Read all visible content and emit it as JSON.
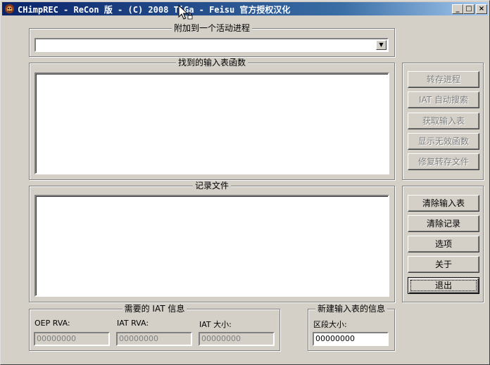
{
  "window": {
    "title": "CHimpREC - ReCon 版 - (C) 2008 TiGa - Feisu 官方授权汉化",
    "controls": {
      "minimize": "_",
      "maximize": "□",
      "close": "×"
    }
  },
  "attach": {
    "title": "附加到一个活动进程",
    "selected": ""
  },
  "imports": {
    "title": "找到的输入表函数"
  },
  "log": {
    "title": "记录文件"
  },
  "buttons_top": [
    {
      "label": "转存进程",
      "enabled": false
    },
    {
      "label": "IAT 自动搜索",
      "enabled": false
    },
    {
      "label": "获取输入表",
      "enabled": false
    },
    {
      "label": "显示无效函数",
      "enabled": false
    },
    {
      "label": "修复转存文件",
      "enabled": false
    }
  ],
  "buttons_bottom": [
    {
      "label": "清除输入表"
    },
    {
      "label": "清除记录"
    },
    {
      "label": "选项"
    },
    {
      "label": "关于"
    },
    {
      "label": "退出"
    }
  ],
  "iat_info": {
    "title": "需要的 IAT 信息",
    "oep_label": "OEP RVA:",
    "oep_value": "00000000",
    "iat_rva_label": "IAT RVA:",
    "iat_rva_value": "00000000",
    "iat_size_label": "IAT 大小:",
    "iat_size_value": "00000000"
  },
  "new_iat": {
    "title": "新建输入表的信息",
    "section_size_label": "区段大小:",
    "section_size_value": "00000000"
  },
  "icons": {
    "app": "chimprec-app-icon",
    "cursor": "mouse-pointer-icon"
  },
  "colors": {
    "title_start": "#0a246a",
    "title_end": "#a6caf0",
    "face": "#d4d0c8"
  }
}
